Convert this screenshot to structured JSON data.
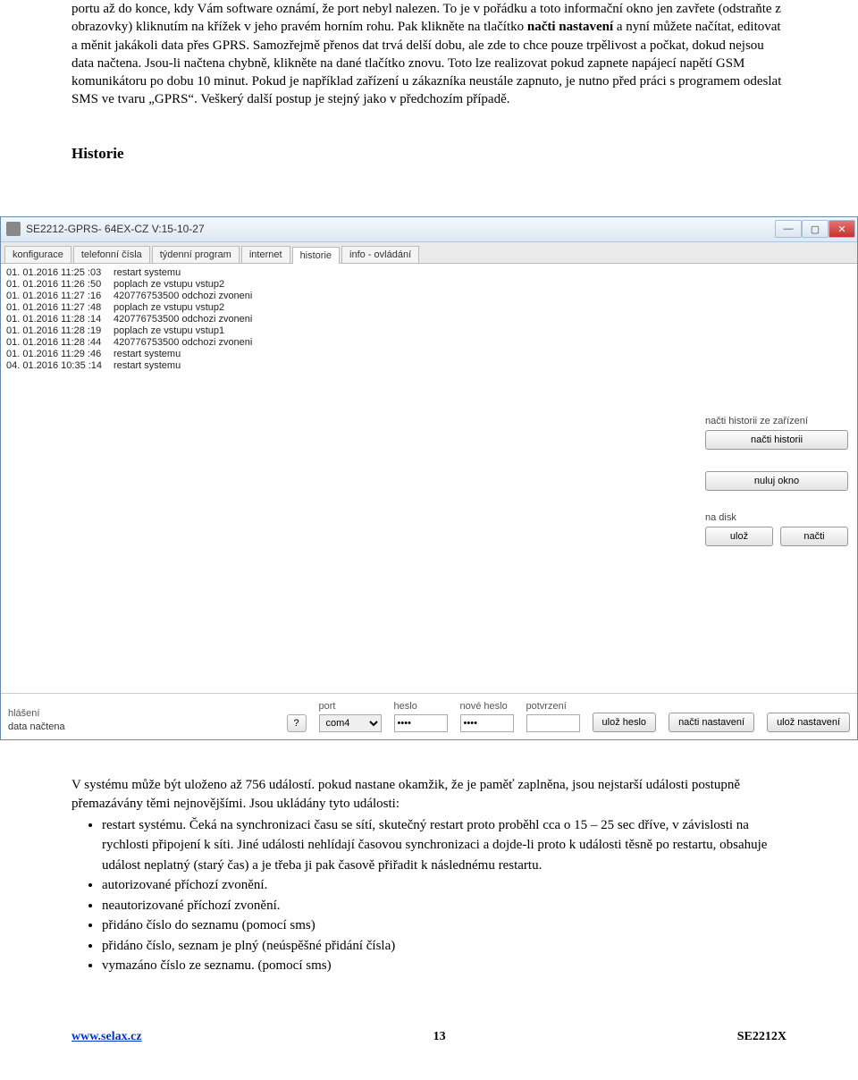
{
  "para1_a": "portu až do konce, kdy Vám software oznámí, že port nebyl nalezen. To je v pořádku a toto informační okno jen zavřete (odstraňte z obrazovky) kliknutím na křížek v jeho pravém horním rohu. Pak klikněte na tlačítko ",
  "para1_b": "načti nastavení",
  "para1_c": " a nyní můžete načítat, editovat a měnit jakákoli data přes GPRS. Samozřejmě přenos dat trvá delší dobu, ale zde to chce pouze trpělivost a počkat, dokud nejsou data načtena. Jsou-li načtena chybně, klikněte na dané tlačítko znovu. Toto lze realizovat pokud zapnete napájecí napětí GSM komunikátoru po dobu 10 minut. Pokud je například zařízení u zákazníka neustále zapnuto, je nutno před práci s programem odeslat SMS ve tvaru „GPRS“. Veškerý další postup je stejný jako v předchozím případě.",
  "heading1": "Historie",
  "window": {
    "title": "SE2212-GPRS- 64EX-CZ V:15-10-27",
    "tabs": [
      "konfigurace",
      "telefonní čísla",
      "týdenní program",
      "internet",
      "historie",
      "info - ovládání"
    ],
    "active_tab": 4,
    "history": [
      {
        "t": "01. 01.2016 11:25 :03",
        "msg": "restart systemu"
      },
      {
        "t": "01. 01.2016 11:26 :50",
        "msg": "poplach ze vstupu vstup2"
      },
      {
        "t": "01. 01.2016 11:27 :16",
        "msg": "420776753500 odchozi zvoneni"
      },
      {
        "t": "01. 01.2016 11:27 :48",
        "msg": "poplach ze vstupu vstup2"
      },
      {
        "t": "01. 01.2016 11:28 :14",
        "msg": "420776753500 odchozi zvoneni"
      },
      {
        "t": "01. 01.2016 11:28 :19",
        "msg": "poplach ze vstupu vstup1"
      },
      {
        "t": "01. 01.2016 11:28 :44",
        "msg": "420776753500 odchozi zvoneni"
      },
      {
        "t": "01. 01.2016 11:29 :46",
        "msg": "restart systemu"
      },
      {
        "t": "04. 01.2016 10:35 :14",
        "msg": "restart systemu"
      }
    ],
    "right": {
      "label1": "načti historii ze zařízení",
      "btn_load_hist": "načti historii",
      "btn_clear": "nuluj okno",
      "label_disk": "na disk",
      "btn_save": "ulož",
      "btn_load": "načti"
    },
    "bottom": {
      "hlaseni_lbl": "hlášení",
      "status": "data načtena",
      "port_lbl": "port",
      "port_val": "com4",
      "heslo_lbl": "heslo",
      "heslo_val": "••••",
      "newpw_lbl": "nové heslo",
      "newpw_val": "••••",
      "confirm_lbl": "potvrzení",
      "btn_savepw": "ulož heslo",
      "btn_readset": "načti nastavení",
      "btn_saveset": "ulož nastavení",
      "q": "?"
    }
  },
  "under_para": "V systému může být uloženo až 756 událostí. pokud nastane okamžik, že je paměť zaplněna, jsou nejstarší události postupně přemazávány těmi nejnovějšími. Jsou ukládány tyto události:",
  "bullets": [
    "restart systému. Čeká na synchronizaci času se sítí, skutečný restart proto proběhl cca o 15 – 25 sec dříve, v závislosti na rychlosti připojení k síti. Jiné události nehlídají časovou synchronizaci a dojde-li proto k události těsně po restartu, obsahuje událost neplatný (starý čas) a je třeba ji pak časově přiřadit k následnému restartu.",
    "autorizované příchozí zvonění.",
    "neautorizované příchozí zvonění.",
    "přidáno číslo do seznamu (pomocí sms)",
    "přidáno číslo, seznam je plný (neúspěšné přidání čísla)",
    "vymazáno číslo ze seznamu. (pomocí sms)"
  ],
  "footer": {
    "link": "www.selax.cz",
    "page": "13",
    "code": "SE2212X"
  }
}
